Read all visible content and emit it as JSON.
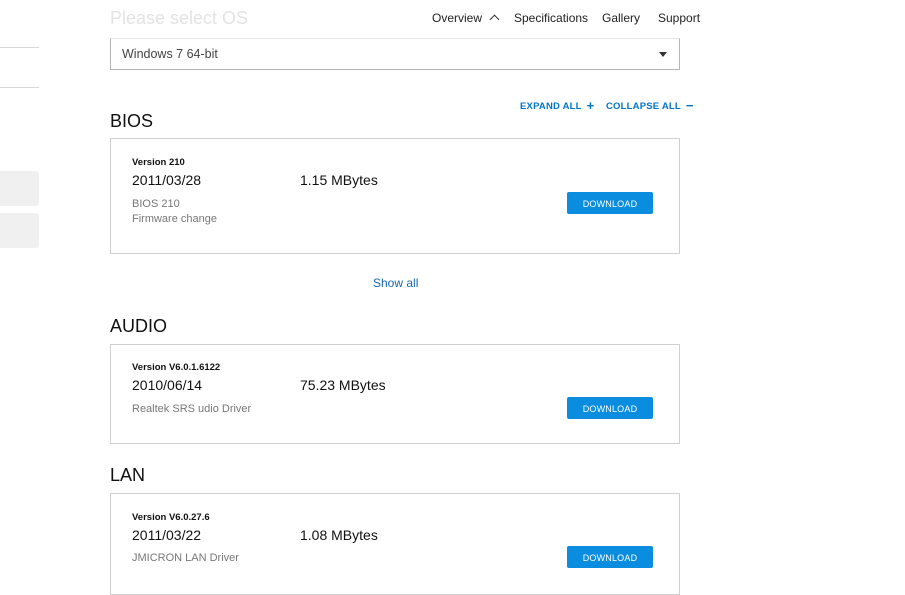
{
  "header": {
    "title": "Please select OS",
    "nav": [
      {
        "label": "Overview",
        "icon": "chevron-up-icon"
      },
      {
        "label": "Specifications"
      },
      {
        "label": "Gallery"
      },
      {
        "label": "Support"
      }
    ]
  },
  "os_select": {
    "value": "Windows 7 64-bit",
    "icon": "caret-down-icon"
  },
  "controls": {
    "expand_all": "EXPAND ALL",
    "expand_symbol": "+",
    "collapse_all": "COLLAPSE ALL",
    "collapse_symbol": "−"
  },
  "colors": {
    "accent": "#0a8ddf",
    "link": "#0076c8"
  },
  "sections": [
    {
      "title": "BIOS",
      "item": {
        "version": "Version 210",
        "date": "2011/03/28",
        "size": "1.15 MBytes",
        "desc_lines": [
          "BIOS 210",
          "Firmware change"
        ],
        "button": "DOWNLOAD"
      },
      "show_all": "Show all"
    },
    {
      "title": "AUDIO",
      "item": {
        "version": "Version V6.0.1.6122",
        "date": "2010/06/14",
        "size": "75.23 MBytes",
        "desc_lines": [
          "Realtek SRS udio Driver"
        ],
        "button": "DOWNLOAD"
      }
    },
    {
      "title": "LAN",
      "item": {
        "version": "Version V6.0.27.6",
        "date": "2011/03/22",
        "size": "1.08 MBytes",
        "desc_lines": [
          "JMICRON LAN Driver"
        ],
        "button": "DOWNLOAD"
      }
    }
  ]
}
